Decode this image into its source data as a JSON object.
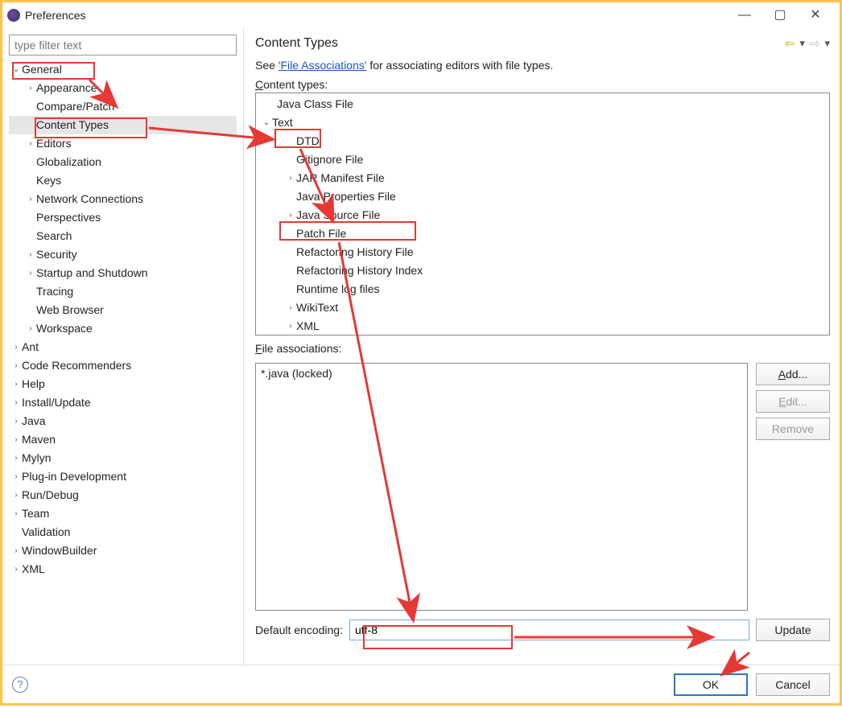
{
  "window": {
    "title": "Preferences"
  },
  "sidebar": {
    "filter_placeholder": "type filter text",
    "items": [
      {
        "label": "General",
        "expanded": true,
        "children": [
          {
            "label": "Appearance",
            "chev": true
          },
          {
            "label": "Compare/Patch"
          },
          {
            "label": "Content Types",
            "selected": true
          },
          {
            "label": "Editors",
            "chev": true
          },
          {
            "label": "Globalization"
          },
          {
            "label": "Keys"
          },
          {
            "label": "Network Connections",
            "chev": true
          },
          {
            "label": "Perspectives"
          },
          {
            "label": "Search"
          },
          {
            "label": "Security",
            "chev": true
          },
          {
            "label": "Startup and Shutdown",
            "chev": true
          },
          {
            "label": "Tracing"
          },
          {
            "label": "Web Browser"
          },
          {
            "label": "Workspace",
            "chev": true
          }
        ]
      },
      {
        "label": "Ant",
        "chev": true
      },
      {
        "label": "Code Recommenders",
        "chev": true
      },
      {
        "label": "Help",
        "chev": true
      },
      {
        "label": "Install/Update",
        "chev": true
      },
      {
        "label": "Java",
        "chev": true
      },
      {
        "label": "Maven",
        "chev": true
      },
      {
        "label": "Mylyn",
        "chev": true
      },
      {
        "label": "Plug-in Development",
        "chev": true
      },
      {
        "label": "Run/Debug",
        "chev": true
      },
      {
        "label": "Team",
        "chev": true
      },
      {
        "label": "Validation"
      },
      {
        "label": "WindowBuilder",
        "chev": true
      },
      {
        "label": "XML",
        "chev": true
      }
    ]
  },
  "main": {
    "title": "Content Types",
    "desc_prefix": "See ",
    "desc_link": "'File Associations'",
    "desc_suffix": " for associating editors with file types.",
    "content_types_label": "Content types:",
    "content_types": [
      {
        "label": "Java Class File",
        "indent": 0
      },
      {
        "label": "Text",
        "indent": 1,
        "chev": "down"
      },
      {
        "label": "DTD",
        "indent": 2
      },
      {
        "label": "Gitignore File",
        "indent": 2
      },
      {
        "label": "JAR Manifest File",
        "indent": 2,
        "chev": "right"
      },
      {
        "label": "Java Properties File",
        "indent": 2
      },
      {
        "label": "Java Source File",
        "indent": 2,
        "chev": "right",
        "hl": true
      },
      {
        "label": "Patch File",
        "indent": 2
      },
      {
        "label": "Refactoring History File",
        "indent": 2
      },
      {
        "label": "Refactoring History Index",
        "indent": 2
      },
      {
        "label": "Runtime log files",
        "indent": 2
      },
      {
        "label": "WikiText",
        "indent": 2,
        "chev": "right"
      },
      {
        "label": "XML",
        "indent": 2,
        "chev": "right"
      }
    ],
    "file_assoc_label": "File associations:",
    "file_assoc_items": [
      "*.java (locked)"
    ],
    "buttons": {
      "add": "Add...",
      "edit": "Edit...",
      "remove": "Remove"
    },
    "encoding_label": "Default encoding:",
    "encoding_value": "utf-8",
    "update": "Update"
  },
  "footer": {
    "ok": "OK",
    "cancel": "Cancel"
  }
}
